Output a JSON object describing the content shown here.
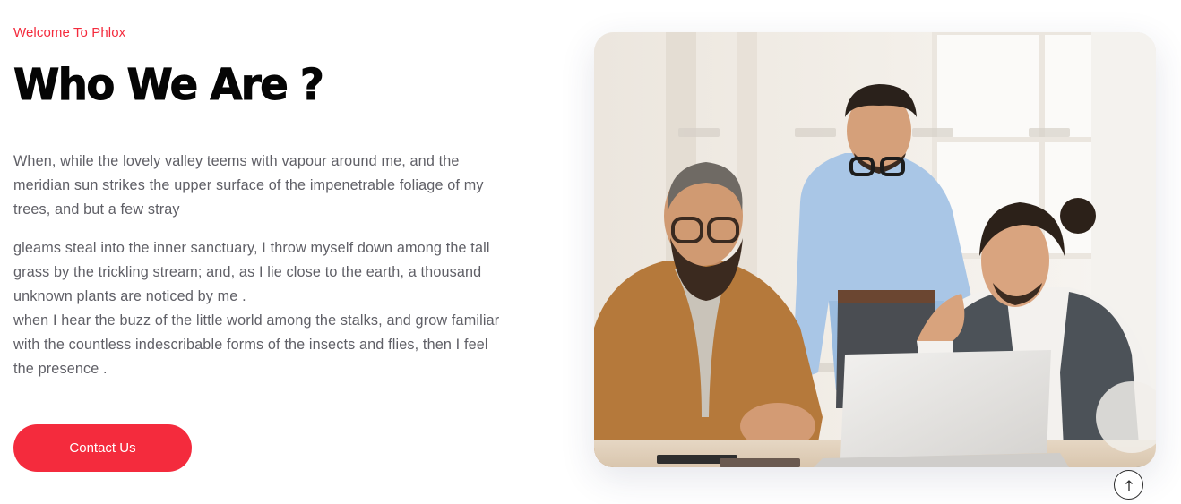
{
  "section": {
    "eyebrow": "Welcome To Phlox",
    "title": "Who We Are ?",
    "paragraph_1": "When, while the lovely valley teems with vapour around me, and the meridian sun strikes the upper surface of the impenetrable foliage of my trees, and but a few stray",
    "paragraph_2_line_1": "gleams steal into the inner sanctuary, I throw myself down among the tall grass by the trickling stream; and, as I lie close to the earth, a thousand unknown plants are noticed by me .",
    "paragraph_2_line_2": "when I hear the buzz of the little world among the stalks, and grow familiar with the countless indescribable forms of the insects and flies, then I feel the presence .",
    "cta_label": "Contact Us"
  },
  "photo": {
    "icon": "team-photo"
  },
  "scroll_top": {
    "icon": "arrow-up-icon"
  },
  "colors": {
    "accent": "#f42b3d",
    "heading": "#050505",
    "body_text": "#5f5f66",
    "background": "#ffffff"
  }
}
